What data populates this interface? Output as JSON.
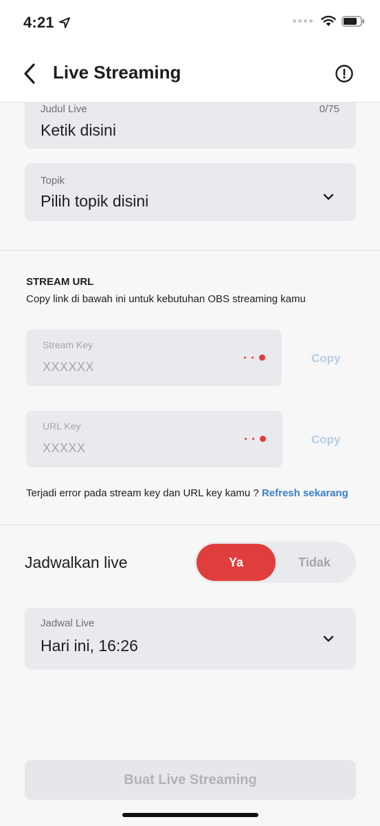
{
  "status_bar": {
    "time": "4:21"
  },
  "header": {
    "title": "Live Streaming"
  },
  "form": {
    "title_field": {
      "label": "Judul Live",
      "placeholder": "Ketik disini",
      "counter": "0/75"
    },
    "topic_field": {
      "label": "Topik",
      "placeholder": "Pilih topik disini"
    }
  },
  "stream_url": {
    "title": "STREAM URL",
    "description": "Copy link di bawah ini untuk kebutuhan OBS streaming kamu",
    "stream_key": {
      "label": "Stream Key",
      "value": "XXXXXX",
      "copy_label": "Copy"
    },
    "url_key": {
      "label": "URL Key",
      "value": "XXXXX",
      "copy_label": "Copy"
    },
    "error_text": "Terjadi error pada stream key dan URL key kamu ?",
    "refresh_label": "Refresh sekarang"
  },
  "schedule": {
    "label": "Jadwalkan live",
    "toggle_yes": "Ya",
    "toggle_no": "Tidak",
    "selected": "Ya",
    "date_field": {
      "label": "Jadwal Live",
      "value": "Hari ini, 16:26"
    }
  },
  "submit": {
    "label": "Buat Live Streaming"
  },
  "colors": {
    "accent": "#e03d3d",
    "link": "#3a7fc6",
    "field_bg": "#e9eaed"
  }
}
